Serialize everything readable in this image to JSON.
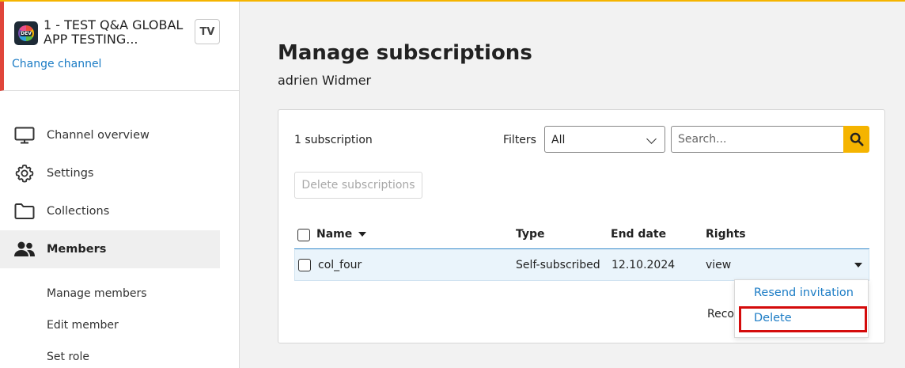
{
  "accent_color": "#f5b400",
  "link_color": "#1b7cc5",
  "channel": {
    "name": "1 - TEST Q&A GLOBAL APP TESTING...",
    "logo_text": "DEV",
    "badge": "TV",
    "change_label": "Change channel"
  },
  "nav": {
    "items": [
      {
        "label": "Channel overview",
        "icon": "monitor-icon"
      },
      {
        "label": "Settings",
        "icon": "gear-icon"
      },
      {
        "label": "Collections",
        "icon": "folder-icon"
      },
      {
        "label": "Members",
        "icon": "people-icon",
        "active": true
      }
    ],
    "subitems": [
      {
        "label": "Manage members"
      },
      {
        "label": "Edit member"
      },
      {
        "label": "Set role"
      }
    ]
  },
  "page": {
    "title": "Manage subscriptions",
    "subtitle": "adrien Widmer"
  },
  "toolbar": {
    "count": "1 subscription",
    "filters_label": "Filters",
    "filter_value": "All",
    "search_placeholder": "Search...",
    "delete_label": "Delete subscriptions"
  },
  "table": {
    "headers": {
      "name": "Name",
      "type": "Type",
      "end_date": "End date",
      "rights": "Rights"
    },
    "rows": [
      {
        "name": "col_four",
        "type": "Self-subscribed",
        "end_date": "12.10.2024",
        "rights": "view"
      }
    ],
    "footer_text": "Reco"
  },
  "row_menu": {
    "items": [
      {
        "label": "Resend invitation"
      },
      {
        "label": "Delete",
        "highlighted": true
      }
    ]
  }
}
